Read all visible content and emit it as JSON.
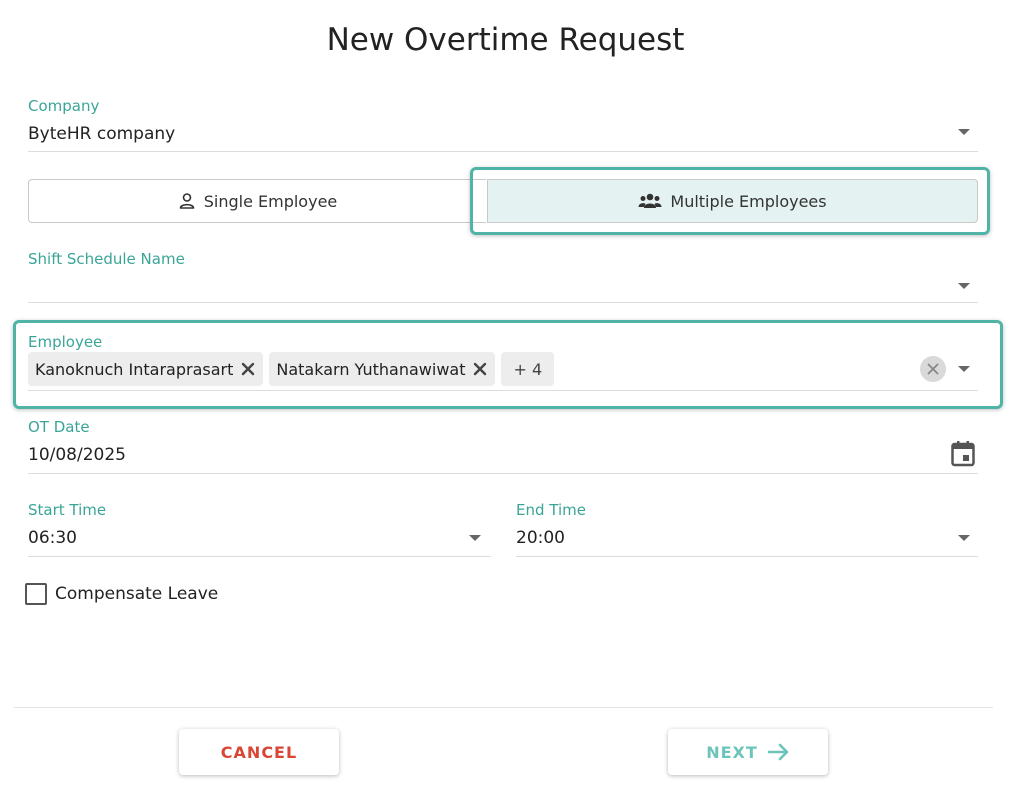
{
  "title": "New Overtime Request",
  "company": {
    "label": "Company",
    "value": "ByteHR company"
  },
  "mode": {
    "single_label": "Single Employee",
    "multiple_label": "Multiple Employees",
    "selected": "multiple"
  },
  "shift": {
    "label": "Shift Schedule Name",
    "value": ""
  },
  "employee": {
    "label": "Employee",
    "chips": [
      "Kanoknuch Intaraprasart",
      "Natakarn Yuthanawiwat"
    ],
    "more_label": "+ 4"
  },
  "ot_date": {
    "label": "OT Date",
    "value": "10/08/2025"
  },
  "start_time": {
    "label": "Start Time",
    "value": "06:30"
  },
  "end_time": {
    "label": "End Time",
    "value": "20:00"
  },
  "compensate": {
    "label": "Compensate Leave",
    "checked": false
  },
  "buttons": {
    "cancel": "CANCEL",
    "next": "NEXT"
  },
  "colors": {
    "accent": "#4fb3a5",
    "label": "#3aa597",
    "cancel": "#d94636",
    "next": "#6cc5b8",
    "selected_bg": "#e4f3f1"
  },
  "icons": [
    "person-icon",
    "group-icon",
    "close-icon",
    "clear-icon",
    "chevron-down-icon",
    "calendar-icon",
    "arrow-right-icon"
  ]
}
